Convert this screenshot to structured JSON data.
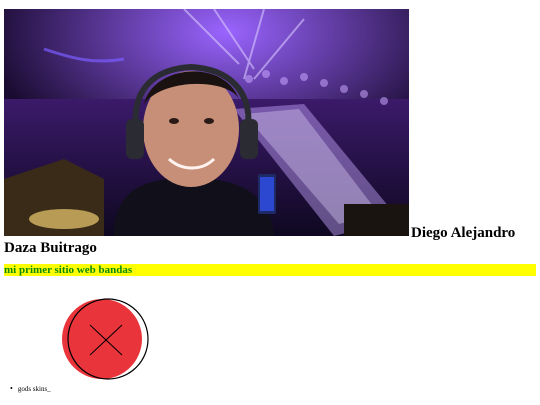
{
  "page": {
    "name_line1": "Diego Alejandro",
    "name_line2": "Daza Buitrago",
    "banner": "mi primer sitio web bandas",
    "list_items": [
      "gods skins_"
    ]
  },
  "colors": {
    "banner_bg": "#ffff00",
    "banner_text": "#0a8a0a",
    "badge_fill": "#e8343a",
    "badge_outline": "#000000"
  },
  "icons": {
    "hero": "dj-selfie-photo",
    "badge": "red-circle-x-icon"
  }
}
